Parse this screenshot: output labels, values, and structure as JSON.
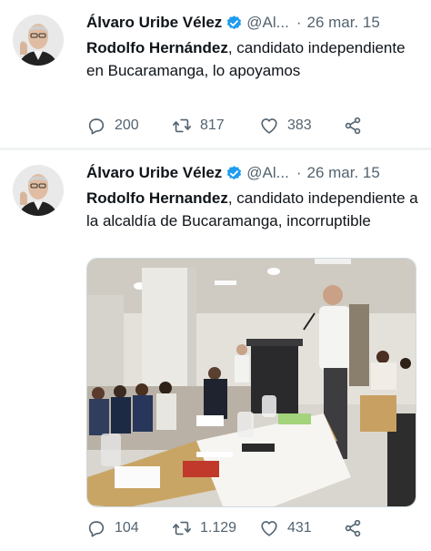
{
  "tweets": [
    {
      "author_name": "Álvaro Uribe Vélez",
      "handle": "@Al...",
      "separator": "·",
      "date": "26 mar. 15",
      "text_bold": "Rodolfo Hernández",
      "text_rest": ", candidato independiente en Bucaramanga, lo apoyamos",
      "replies": "200",
      "retweets": "817",
      "likes": "383",
      "has_media": false
    },
    {
      "author_name": "Álvaro Uribe Vélez",
      "handle": "@Al...",
      "separator": "·",
      "date": "26 mar. 15",
      "text_bold": "Rodolfo Hernandez",
      "text_rest": ", candidato independiente a la alcaldía de Bucaramanga, incorruptible",
      "replies": "104",
      "retweets": "1.129",
      "likes": "431",
      "has_media": true
    }
  ],
  "icons": {
    "verified": "verified-badge-icon",
    "reply": "reply-icon",
    "retweet": "retweet-icon",
    "like": "heart-icon",
    "share": "share-icon"
  },
  "colors": {
    "text": "#0f1419",
    "secondary": "#536471",
    "verified": "#1d9bf0",
    "divider": "#eff3f4"
  }
}
